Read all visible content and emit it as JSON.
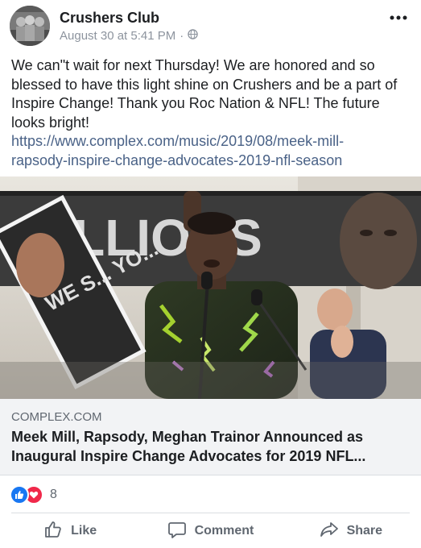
{
  "post": {
    "author": "Crushers Club",
    "timestamp": "August 30 at 5:41 PM",
    "separator": "·",
    "privacy_icon": "globe-icon",
    "more_icon": "more-options-icon",
    "text_lines": [
      "We can\"t wait for next Thursday! We are honored and so",
      "blessed to have this light shine on Crushers and be a part of",
      "Inspire Change! Thank you Roc Nation & NFL! The future",
      "looks bright!"
    ],
    "link_lines": [
      "https://www.complex.com/music/2019/08/meek-mill-",
      "rapsody-inspire-change-advocates-2019-nfl-season"
    ]
  },
  "photo": {
    "banner_text": "MILLIONS",
    "sign_text": "WE S... YO..."
  },
  "link_card": {
    "domain": "COMPLEX.COM",
    "title_lines": [
      "Meek Mill, Rapsody, Meghan Trainor Announced as",
      "Inaugural Inspire Change Advocates for 2019 NFL..."
    ]
  },
  "reactions": {
    "icons": [
      "like-reaction-icon",
      "love-reaction-icon"
    ],
    "count": "8"
  },
  "actions": {
    "like": "Like",
    "comment": "Comment",
    "share": "Share"
  },
  "colors": {
    "link": "#4a6287",
    "meta": "#8d949e",
    "like_blue": "#1877f2",
    "love_red": "#f0284a",
    "card_bg": "#f2f3f5"
  }
}
